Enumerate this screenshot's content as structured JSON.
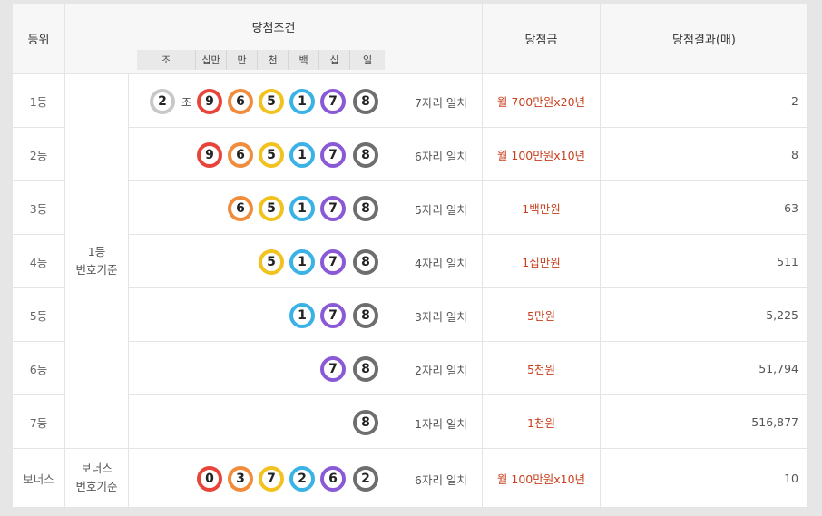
{
  "header": {
    "rank": "등위",
    "condition": "당첨조건",
    "prize": "당첨금",
    "result": "당첨결과(매)",
    "positions": [
      "조",
      "십만",
      "만",
      "천",
      "백",
      "십",
      "일"
    ]
  },
  "group_label": [
    "1등",
    "번호기준"
  ],
  "bonus_group_label": [
    "보너스",
    "번호기준"
  ],
  "colors": {
    "red": "#e8443a",
    "orange": "#f08c3c",
    "yellow": "#f2c21f",
    "blue": "#3ab2e6",
    "purple": "#8a5ad6",
    "gray": "#6e6e6e",
    "white": "#c8c8c8",
    "prize_text": "#c8401e"
  },
  "rows": [
    {
      "rank": "1등",
      "jo": "2",
      "jo_label": "조",
      "digits": [
        "9",
        "6",
        "5",
        "1",
        "7",
        "8"
      ],
      "match": "7자리 일치",
      "prize": "월 700만원x20년",
      "count": "2"
    },
    {
      "rank": "2등",
      "digits": [
        "9",
        "6",
        "5",
        "1",
        "7",
        "8"
      ],
      "match": "6자리 일치",
      "prize": "월 100만원x10년",
      "count": "8"
    },
    {
      "rank": "3등",
      "digits": [
        "6",
        "5",
        "1",
        "7",
        "8"
      ],
      "match": "5자리 일치",
      "prize": "1백만원",
      "count": "63"
    },
    {
      "rank": "4등",
      "digits": [
        "5",
        "1",
        "7",
        "8"
      ],
      "match": "4자리 일치",
      "prize": "1십만원",
      "count": "511"
    },
    {
      "rank": "5등",
      "digits": [
        "1",
        "7",
        "8"
      ],
      "match": "3자리 일치",
      "prize": "5만원",
      "count": "5,225"
    },
    {
      "rank": "6등",
      "digits": [
        "7",
        "8"
      ],
      "match": "2자리 일치",
      "prize": "5천원",
      "count": "51,794"
    },
    {
      "rank": "7등",
      "digits": [
        "8"
      ],
      "match": "1자리 일치",
      "prize": "1천원",
      "count": "516,877"
    }
  ],
  "bonus": {
    "rank": "보너스",
    "digits": [
      "0",
      "3",
      "7",
      "2",
      "6",
      "2"
    ],
    "match": "6자리 일치",
    "prize": "월 100만원x10년",
    "count": "10"
  }
}
